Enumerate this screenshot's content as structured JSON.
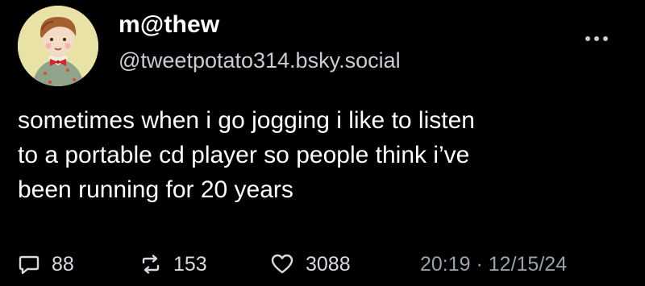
{
  "post": {
    "display_name": "m@thew",
    "handle": "@tweetpotato314.bsky.social",
    "text_lines": [
      "sometimes when i go jogging i like to listen",
      "to a portable cd player so people think i’ve",
      "been running for 20 years"
    ],
    "more_icon": "ellipsis-icon",
    "avatar_icon": "avatar-illustration"
  },
  "actions": {
    "replies": {
      "icon": "comment-icon",
      "count": "88"
    },
    "reposts": {
      "icon": "repost-icon",
      "count": "153"
    },
    "likes": {
      "icon": "heart-icon",
      "count": "3088"
    }
  },
  "timestamp": "20:19 · 12/15/24",
  "colors": {
    "background": "#000000",
    "text": "#ffffff",
    "secondary_text": "#c9cdd3",
    "muted_text": "#9aa1aa"
  }
}
